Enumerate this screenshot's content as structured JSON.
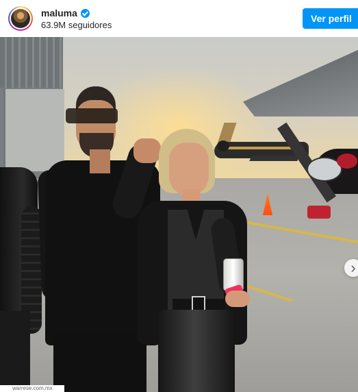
{
  "header": {
    "username": "maluma",
    "followers": "63.9M seguidores",
    "profile_button": "Ver perfil"
  },
  "photo": {
    "watermark": "warrese.com.mx"
  },
  "colors": {
    "accent_blue": "#0095f6",
    "verified_blue": "#0095f6"
  },
  "icons": {
    "verified": "verified-badge-icon",
    "next": "chevron-right-icon"
  }
}
